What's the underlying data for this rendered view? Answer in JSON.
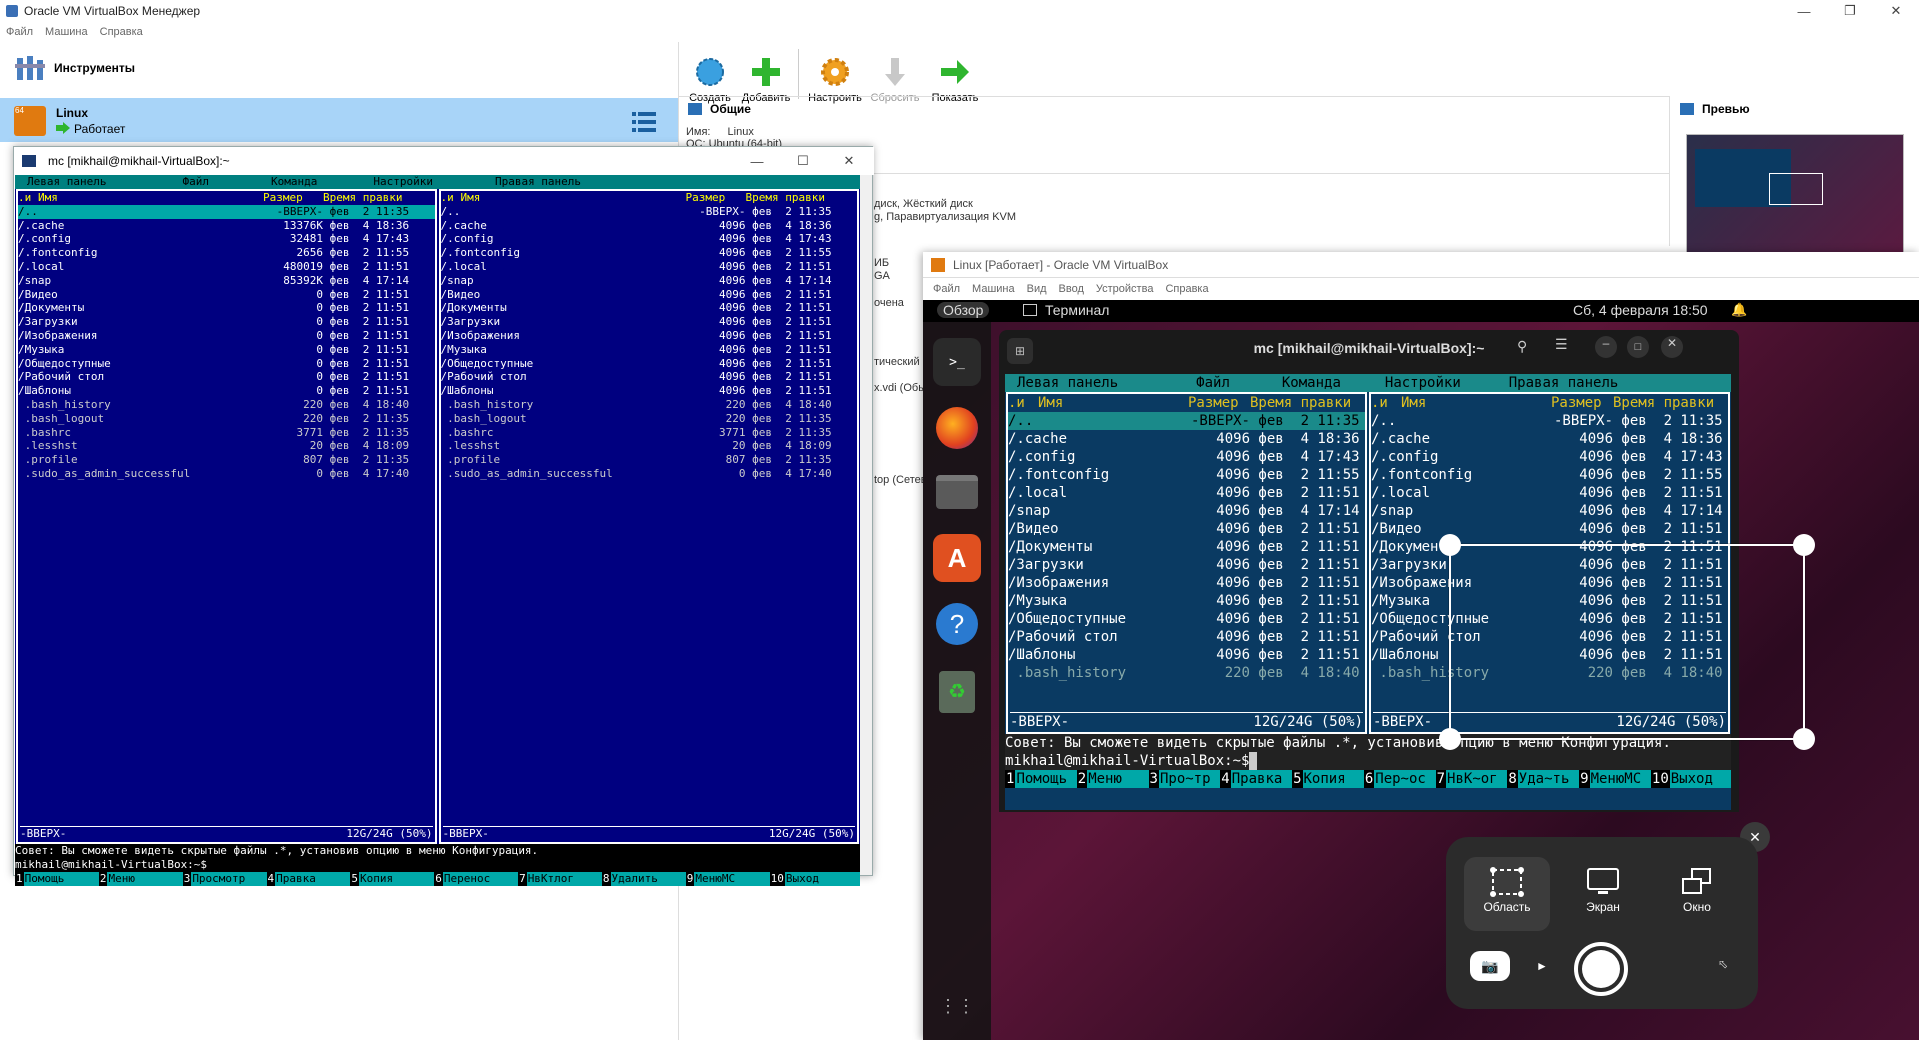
{
  "manager": {
    "title": "Oracle VM VirtualBox Менеджер",
    "menu": [
      "Файл",
      "Машина",
      "Справка"
    ],
    "tools_label": "Инструменты",
    "toolbar": [
      {
        "label": "Создать",
        "icon": "create-icon",
        "color": "#3aa0e0"
      },
      {
        "label": "Добавить",
        "icon": "add-icon",
        "color": "#2fb52f"
      },
      {
        "label": "Настроить",
        "icon": "settings-gear-icon",
        "color": "#f0a020"
      },
      {
        "label": "Сбросить",
        "icon": "discard-icon",
        "color": "#c8c8c8"
      },
      {
        "label": "Показать",
        "icon": "show-arrow-icon",
        "color": "#2fb52f"
      }
    ],
    "vm": {
      "name": "Linux",
      "state": "Работает",
      "badge": "64"
    },
    "general": {
      "heading": "Общие",
      "name_key": "Имя:",
      "name_val": "Linux",
      "os_partial": "ОС: Ubuntu (64-bit)"
    },
    "details_fragments": [
      "диск, Жёсткий диск",
      "g, Паравиртуализация KVM",
      "ИБ",
      "GA",
      "очена",
      "тический",
      "x.vdi (Обы",
      "top (Сетев"
    ],
    "preview_heading": "Превью"
  },
  "mc": {
    "title": "mc [mikhail@mikhail-VirtualBox]:~",
    "menu": [
      "Левая панель",
      "Файл",
      "Команда",
      "Настройки",
      "Правая панель"
    ],
    "path": "~",
    "corner": ".[^]>",
    "hdr": {
      "n": ".и",
      "name": "Имя",
      "size": "Размер",
      "time": "Время правки"
    },
    "left": [
      [
        "/..",
        "-ВВЕРХ-",
        "фев  2 11:35"
      ],
      [
        "/.cache",
        "13376K",
        "фев  4 18:36"
      ],
      [
        "/.config",
        "32481",
        "фев  4 17:43"
      ],
      [
        "/.fontconfig",
        "2656",
        "фев  2 11:55"
      ],
      [
        "/.local",
        "480019",
        "фев  2 11:51"
      ],
      [
        "/snap",
        "85392K",
        "фев  4 17:14"
      ],
      [
        "/Видео",
        "0",
        "фев  2 11:51"
      ],
      [
        "/Документы",
        "0",
        "фев  2 11:51"
      ],
      [
        "/Загрузки",
        "0",
        "фев  2 11:51"
      ],
      [
        "/Изображения",
        "0",
        "фев  2 11:51"
      ],
      [
        "/Музыка",
        "0",
        "фев  2 11:51"
      ],
      [
        "/Общедоступные",
        "0",
        "фев  2 11:51"
      ],
      [
        "/Рабочий стол",
        "0",
        "фев  2 11:51"
      ],
      [
        "/Шаблоны",
        "0",
        "фев  2 11:51"
      ],
      [
        " .bash_history",
        "220",
        "фев  4 18:40"
      ],
      [
        " .bash_logout",
        "220",
        "фев  2 11:35"
      ],
      [
        " .bashrc",
        "3771",
        "фев  2 11:35"
      ],
      [
        " .lesshst",
        "20",
        "фев  4 18:09"
      ],
      [
        " .profile",
        "807",
        "фев  2 11:35"
      ],
      [
        " .sudo_as_admin_successful",
        "0",
        "фев  4 17:40"
      ]
    ],
    "right": [
      [
        "/..",
        "-ВВЕРХ-",
        "фев  2 11:35"
      ],
      [
        "/.cache",
        "4096",
        "фев  4 18:36"
      ],
      [
        "/.config",
        "4096",
        "фев  4 17:43"
      ],
      [
        "/.fontconfig",
        "4096",
        "фев  2 11:55"
      ],
      [
        "/.local",
        "4096",
        "фев  2 11:51"
      ],
      [
        "/snap",
        "4096",
        "фев  4 17:14"
      ],
      [
        "/Видео",
        "4096",
        "фев  2 11:51"
      ],
      [
        "/Документы",
        "4096",
        "фев  2 11:51"
      ],
      [
        "/Загрузки",
        "4096",
        "фев  2 11:51"
      ],
      [
        "/Изображения",
        "4096",
        "фев  2 11:51"
      ],
      [
        "/Музыка",
        "4096",
        "фев  2 11:51"
      ],
      [
        "/Общедоступные",
        "4096",
        "фев  2 11:51"
      ],
      [
        "/Рабочий стол",
        "4096",
        "фев  2 11:51"
      ],
      [
        "/Шаблоны",
        "4096",
        "фев  2 11:51"
      ],
      [
        " .bash_history",
        "220",
        "фев  4 18:40"
      ],
      [
        " .bash_logout",
        "220",
        "фев  2 11:35"
      ],
      [
        " .bashrc",
        "3771",
        "фев  2 11:35"
      ],
      [
        " .lesshst",
        "20",
        "фев  4 18:09"
      ],
      [
        " .profile",
        "807",
        "фев  2 11:35"
      ],
      [
        " .sudo_as_admin_successful",
        "0",
        "фев  4 17:40"
      ]
    ],
    "status": "-ВВЕРХ-",
    "disk": "12G/24G (50%)",
    "hint": "Совет: Вы сможете видеть скрытые файлы .*, установив опцию в меню Конфигурация.",
    "prompt": "mikhail@mikhail-VirtualBox:~$",
    "fkeys": [
      [
        "1",
        "Помощь"
      ],
      [
        "2",
        "Меню"
      ],
      [
        "3",
        "Просмотр"
      ],
      [
        "4",
        "Правка"
      ],
      [
        "5",
        "Копия"
      ],
      [
        "6",
        "Перенос"
      ],
      [
        "7",
        "НвКтлог"
      ],
      [
        "8",
        "Удалить"
      ],
      [
        "9",
        "МенюМС"
      ],
      [
        "10",
        "Выход"
      ]
    ]
  },
  "vmwin": {
    "title": "Linux [Работает] - Oracle VM VirtualBox",
    "menu": [
      "Файл",
      "Машина",
      "Вид",
      "Ввод",
      "Устройства",
      "Справка"
    ],
    "activities": "Обзор",
    "app": "Терминал",
    "clock": "Сб, 4 февраля  18:50",
    "term_title": "mc [mikhail@mikhail-VirtualBox]:~",
    "rows_visible": 15,
    "fkeys": [
      [
        "1",
        "Помощь"
      ],
      [
        "2",
        "Меню"
      ],
      [
        "3",
        "Про~тр"
      ],
      [
        "4",
        "Правка"
      ],
      [
        "5",
        "Копия"
      ],
      [
        "6",
        "Пер~ос"
      ],
      [
        "7",
        "НвК~ог"
      ],
      [
        "8",
        "Уда~ть"
      ],
      [
        "9",
        "МенюМС"
      ],
      [
        "10",
        "Выход"
      ]
    ]
  },
  "screenshot": {
    "modes": [
      {
        "label": "Область",
        "icon": "area-select-icon"
      },
      {
        "label": "Экран",
        "icon": "screen-icon"
      },
      {
        "label": "Окно",
        "icon": "window-icon"
      }
    ]
  }
}
